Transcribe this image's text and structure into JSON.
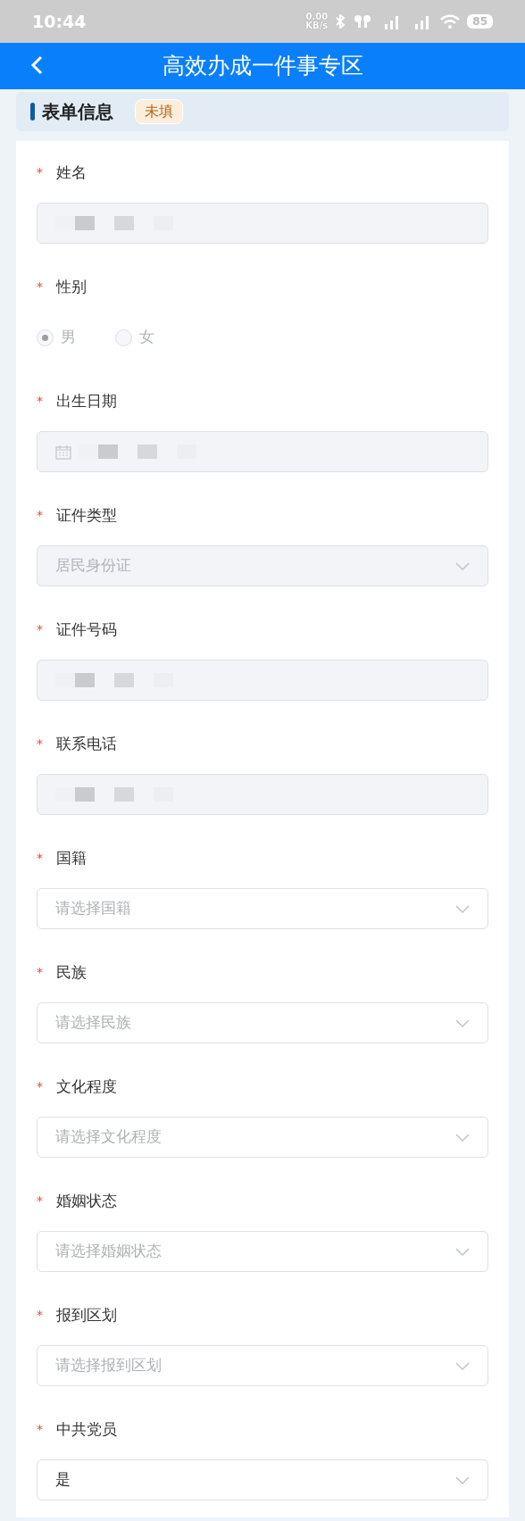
{
  "status_bar": {
    "time": "10:44",
    "net_speed": "0.00",
    "net_unit": "KB/s",
    "battery": "85"
  },
  "header": {
    "title": "高效办成一件事专区"
  },
  "section": {
    "title": "表单信息",
    "badge": "未填"
  },
  "fields": [
    {
      "kind": "text",
      "required_mark": "*",
      "label": "姓名",
      "disabled": true,
      "redacted": true
    },
    {
      "kind": "radio",
      "required_mark": "*",
      "label": "性别",
      "disabled": true,
      "options": [
        {
          "label": "男",
          "selected": true
        },
        {
          "label": "女",
          "selected": false
        }
      ]
    },
    {
      "kind": "date",
      "required_mark": "*",
      "label": "出生日期",
      "disabled": true,
      "redacted": true
    },
    {
      "kind": "select",
      "required_mark": "*",
      "label": "证件类型",
      "disabled": true,
      "value": "居民身份证"
    },
    {
      "kind": "text",
      "required_mark": "*",
      "label": "证件号码",
      "disabled": true,
      "redacted": true
    },
    {
      "kind": "text",
      "required_mark": "*",
      "label": "联系电话",
      "disabled": true,
      "redacted": true
    },
    {
      "kind": "select",
      "required_mark": "*",
      "label": "国籍",
      "disabled": false,
      "placeholder": "请选择国籍"
    },
    {
      "kind": "select",
      "required_mark": "*",
      "label": "民族",
      "disabled": false,
      "placeholder": "请选择民族"
    },
    {
      "kind": "select",
      "required_mark": "*",
      "label": "文化程度",
      "disabled": false,
      "placeholder": "请选择文化程度"
    },
    {
      "kind": "select",
      "required_mark": "*",
      "label": "婚姻状态",
      "disabled": false,
      "placeholder": "请选择婚姻状态"
    },
    {
      "kind": "select",
      "required_mark": "*",
      "label": "报到区划",
      "disabled": false,
      "placeholder": "请选择报到区划"
    },
    {
      "kind": "select",
      "required_mark": "*",
      "label": "中共党员",
      "disabled": false,
      "value": "是"
    }
  ]
}
